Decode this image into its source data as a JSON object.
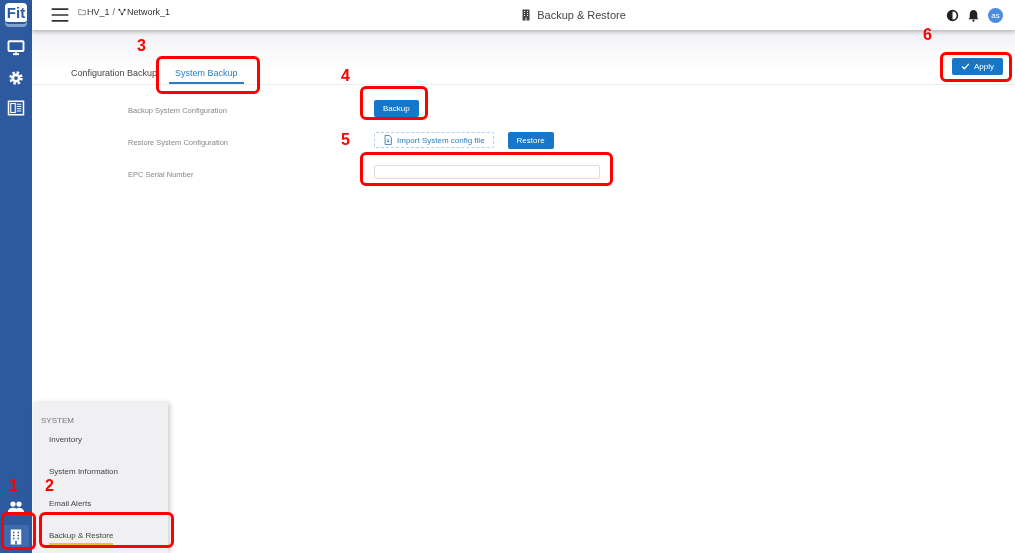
{
  "breadcrumb_separator": "/",
  "breadcrumb": [
    {
      "kind": "folder",
      "label": "HV_1"
    },
    {
      "kind": "network",
      "label": "Network_1"
    }
  ],
  "page_title": "Backup & Restore",
  "user_avatar": "as",
  "sidebar": {
    "logo": "Fit",
    "items": [
      {
        "kind": "monitor",
        "selected": false
      },
      {
        "kind": "gear",
        "selected": false
      },
      {
        "kind": "panel",
        "selected": false
      }
    ],
    "bottom_items": [
      {
        "kind": "users",
        "selected": false
      },
      {
        "kind": "building",
        "selected": true
      }
    ]
  },
  "tabs": [
    {
      "label": "Configuration Backup",
      "selected": false
    },
    {
      "label": "System Backup",
      "selected": true
    }
  ],
  "apply_button": "Apply",
  "form": [
    {
      "label": "Backup System Configuration",
      "kind": "buttons",
      "buttons": [
        {
          "label": "Backup",
          "kind": "primary"
        }
      ]
    },
    {
      "label": "Restore System Configuration",
      "kind": "buttons",
      "buttons": [
        {
          "label": "Import System config file",
          "kind": "file"
        },
        {
          "label": "Restore",
          "kind": "primary"
        }
      ]
    },
    {
      "label": "EPC Serial Number",
      "kind": "input"
    }
  ],
  "menu": {
    "heading": "SYSTEM",
    "items": [
      {
        "label": "Inventory",
        "selected": false
      },
      {
        "label": "System Information",
        "selected": false
      },
      {
        "label": "Email Alerts",
        "selected": false
      },
      {
        "label": "Backup & Restore",
        "selected": true
      }
    ]
  },
  "callouts": [
    {
      "label": "1"
    },
    {
      "label": "2"
    },
    {
      "label": "3"
    },
    {
      "label": "4"
    },
    {
      "label": "5"
    },
    {
      "label": "6"
    }
  ]
}
